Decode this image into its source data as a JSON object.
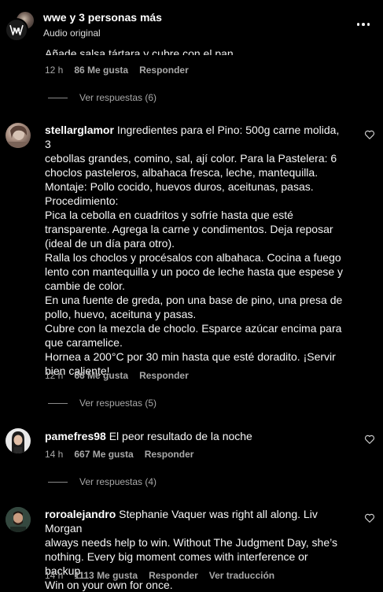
{
  "header": {
    "title": "wwe y 3 personas más",
    "subtitle": "Audio original"
  },
  "truncated_comment": {
    "text": "Añade salsa tártara y cubre con el pan.",
    "time": "12 h",
    "likes": "86 Me gusta",
    "reply_label": "Responder",
    "view_replies": "Ver respuestas (6)"
  },
  "comments": [
    {
      "username": "stellarglamor",
      "lines": [
        "Ingredientes para el Pino: 500g carne molida, 3",
        "cebollas grandes, comino, sal, ají color. Para la Pastelera: 6",
        "choclos pasteleros, albahaca fresca, leche, mantequilla.",
        "Montaje: Pollo cocido, huevos duros, aceitunas, pasas.",
        "Procedimiento:",
        "Pica la cebolla en cuadritos y sofríe hasta que esté",
        "transparente. Agrega la carne y condimentos. Deja reposar",
        "(ideal de un día para otro).",
        "Ralla los choclos y procésalos con albahaca. Cocina a fuego",
        "lento con mantequilla y un poco de leche hasta que espese y",
        "cambie de color.",
        "En una fuente de greda, pon una base de pino, una presa de",
        "pollo, huevo, aceituna y pasas.",
        "Cubre con la mezcla de choclo. Esparce azúcar encima para",
        "que caramelice.",
        "Hornea a 200°C por 30 min hasta que esté doradito. ¡Servir",
        "bien caliente!"
      ],
      "time": "12 h",
      "likes": "66 Me gusta",
      "reply_label": "Responder",
      "view_replies": "Ver respuestas (5)"
    },
    {
      "username": "pamefres98",
      "lines": [
        "El peor resultado de la noche"
      ],
      "time": "14 h",
      "likes": "667 Me gusta",
      "reply_label": "Responder",
      "view_replies": "Ver respuestas (4)"
    },
    {
      "username": "roroalejandro",
      "lines": [
        "Stephanie Vaquer was right all along. Liv Morgan",
        "always needs help to win. Without The Judgment Day, she’s",
        "nothing. Every big moment comes with interference or backup.",
        "Win on your own for once."
      ],
      "time": "14 h",
      "likes": "1113 Me gusta",
      "reply_label": "Responder",
      "translate_label": "Ver traducción"
    }
  ],
  "icons": {
    "more": "more-horizontal-icon",
    "heart": "heart-outline-icon",
    "brand": "wwe-logo-icon"
  },
  "colors": {
    "background": "#000000",
    "text": "#f5f5f5",
    "secondary": "#a8a8a8"
  }
}
